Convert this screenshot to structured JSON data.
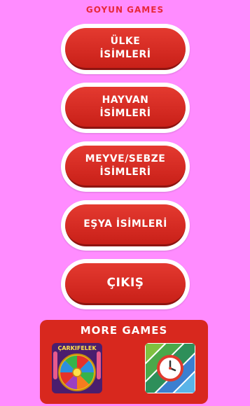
{
  "header": {
    "brand": "GOYUN GAMES"
  },
  "menu": [
    {
      "label": "ÜLKE\nİSİMLERİ"
    },
    {
      "label": "HAYVAN\nİSİMLERİ"
    },
    {
      "label": "MEYVE/SEBZE\nİSİMLERİ"
    },
    {
      "label": "EŞYA İSİMLERİ"
    },
    {
      "label": "ÇIKIŞ"
    }
  ],
  "more_games": {
    "title": "MORE GAMES",
    "games": [
      {
        "name": "ÇARKIFELEK",
        "icon": "wheel-of-fortune-icon"
      },
      {
        "name": "",
        "icon": "clock-puzzle-icon"
      }
    ]
  },
  "colors": {
    "background": "#ff8cff",
    "button_red": "#d42a22",
    "panel_red": "#d8281e"
  }
}
